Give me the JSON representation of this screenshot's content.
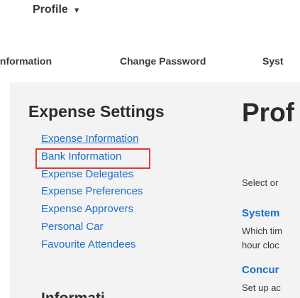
{
  "header": {
    "profile_menu": "Profile",
    "caret": "▼"
  },
  "tabs": [
    {
      "label": "Information"
    },
    {
      "label": "Change Password"
    },
    {
      "label": "Syst"
    }
  ],
  "sidebar": {
    "title": "Expense Settings",
    "items": [
      {
        "label": "Expense Information"
      },
      {
        "label": "Bank Information"
      },
      {
        "label": "Expense Delegates"
      },
      {
        "label": "Expense Preferences"
      },
      {
        "label": "Expense Approvers"
      },
      {
        "label": "Personal Car"
      },
      {
        "label": "Favourite Attendees"
      }
    ],
    "next_section_partial": "Informati"
  },
  "main": {
    "heading": "Prof",
    "intro": "Select or",
    "sections": [
      {
        "title": "System",
        "lines": [
          "Which tim",
          "hour cloc"
        ]
      },
      {
        "title": "Concur",
        "lines": [
          "Set up ac"
        ]
      }
    ]
  },
  "colors": {
    "link": "#1a6fc9",
    "highlight": "#e03a3a",
    "panel_bg": "#f3f3f3"
  }
}
